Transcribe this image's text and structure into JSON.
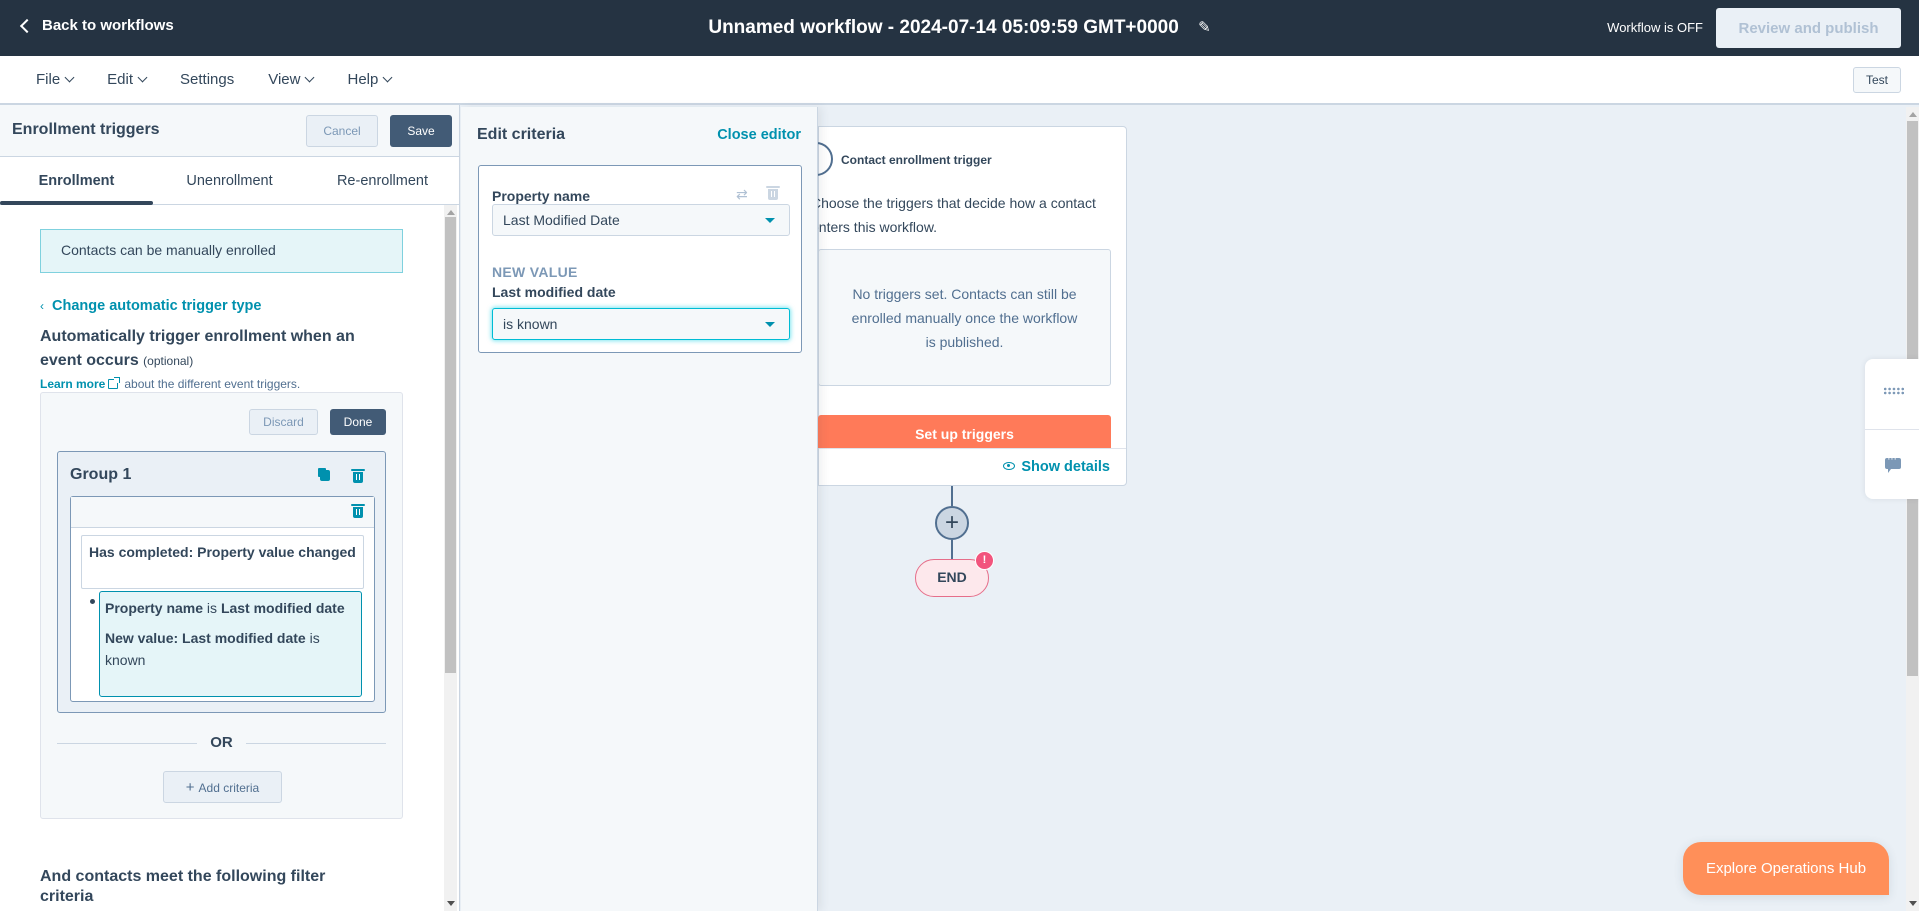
{
  "topbar": {
    "back_label": "Back to workflows",
    "workflow_title": "Unnamed workflow - 2024-07-14 05:09:59 GMT+0000",
    "status": "Workflow is OFF",
    "publish_label": "Review and publish"
  },
  "menubar": {
    "items": [
      {
        "label": "File",
        "has_caret": true
      },
      {
        "label": "Edit",
        "has_caret": true
      },
      {
        "label": "Settings",
        "has_caret": false
      },
      {
        "label": "View",
        "has_caret": true
      },
      {
        "label": "Help",
        "has_caret": true
      }
    ],
    "test_label": "Test"
  },
  "left_panel": {
    "title": "Enrollment triggers",
    "cancel_label": "Cancel",
    "save_label": "Save",
    "tabs": [
      {
        "label": "Enrollment",
        "active": true
      },
      {
        "label": "Unenrollment",
        "active": false
      },
      {
        "label": "Re-enrollment",
        "active": false
      }
    ],
    "manual_notice": "Contacts can be manually enrolled",
    "change_trigger_link": "Change automatic trigger type",
    "auto_heading": "Automatically trigger enrollment when an event occurs",
    "auto_heading_optional": "(optional)",
    "learn_more_link": "Learn more",
    "learn_more_suffix": "about the different event triggers.",
    "discard_label": "Discard",
    "done_label": "Done",
    "group": {
      "title": "Group 1",
      "event": "Has completed: Property value changed",
      "filter": {
        "line1_bold1": "Property name",
        "line1_op": " is ",
        "line1_bold2": "Last modified date",
        "line2_bold": "New value: Last modified date",
        "line2_op": " is ",
        "line2_value": "known"
      }
    },
    "or_label": "OR",
    "add_criteria_label": "Add criteria",
    "filter_heading": "And contacts meet the following filter criteria"
  },
  "edit_panel": {
    "title": "Edit criteria",
    "close_label": "Close editor",
    "property_label": "Property name",
    "property_value": "Last Modified Date",
    "new_value_label": "NEW VALUE",
    "field_label": "Last modified date",
    "operator_value": "is known"
  },
  "canvas": {
    "trigger_title": "Contact enrollment trigger",
    "trigger_desc": "Choose the triggers that decide how a contact enters this workflow.",
    "no_triggers_text": "No triggers set. Contacts can still be enrolled manually once the workflow is published.",
    "setup_label": "Set up triggers",
    "show_details_label": "Show details",
    "add_node_symbol": "+",
    "end_label": "END",
    "end_alert": "!"
  },
  "explore_label": "Explore Operations Hub",
  "colors": {
    "topbar": "#253342",
    "accent": "#0091ae",
    "primary_button": "#425b76",
    "cta": "#ff7a59",
    "alert": "#f2547d"
  }
}
